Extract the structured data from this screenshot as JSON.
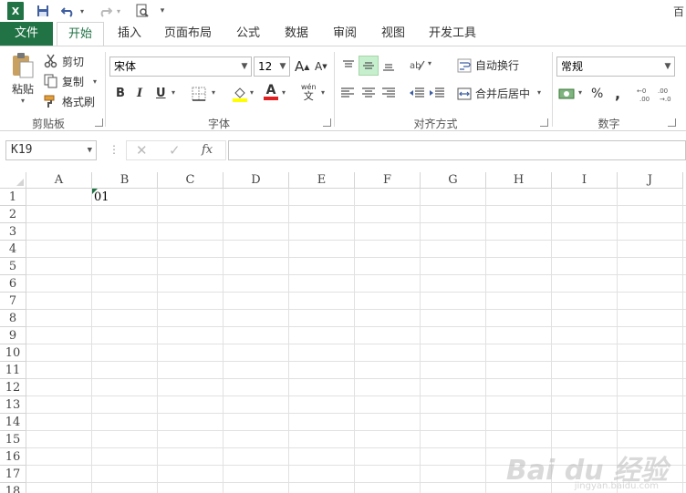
{
  "qat": {
    "app_icon": "X",
    "title_right": "百"
  },
  "tabs": [
    {
      "label": "文件"
    },
    {
      "label": "开始"
    },
    {
      "label": "插入"
    },
    {
      "label": "页面布局"
    },
    {
      "label": "公式"
    },
    {
      "label": "数据"
    },
    {
      "label": "审阅"
    },
    {
      "label": "视图"
    },
    {
      "label": "开发工具"
    }
  ],
  "clipboard": {
    "paste": "粘贴",
    "cut": "剪切",
    "copy": "复制",
    "format_painter": "格式刷",
    "label": "剪贴板"
  },
  "font": {
    "name": "宋体",
    "size": "12",
    "bold": "B",
    "italic": "I",
    "underline": "U",
    "grow": "A",
    "shrink": "A",
    "phonetic_top": "wén",
    "phonetic_bottom": "文",
    "color_a": "A",
    "label": "字体"
  },
  "alignment": {
    "wrap": "自动换行",
    "merge": "合并后居中",
    "label": "对齐方式"
  },
  "number": {
    "format": "常规",
    "percent": "%",
    "comma": ",",
    "label": "数字"
  },
  "formula_bar": {
    "name_box": "K19",
    "fx": "fx",
    "value": ""
  },
  "columns": [
    "A",
    "B",
    "C",
    "D",
    "E",
    "F",
    "G",
    "H",
    "I",
    "J"
  ],
  "rows": [
    "1",
    "2",
    "3",
    "4",
    "5",
    "6",
    "7",
    "8",
    "9",
    "10",
    "11",
    "12",
    "13",
    "14",
    "15",
    "16",
    "17",
    "18"
  ],
  "cells": {
    "B1": "01"
  },
  "watermark": {
    "text": "Bai du 经验",
    "sub": "jingyan.baidu.com"
  },
  "colors": {
    "accent": "#217346",
    "grid": "#e1e1e1",
    "header_border": "#d4d4d4"
  }
}
